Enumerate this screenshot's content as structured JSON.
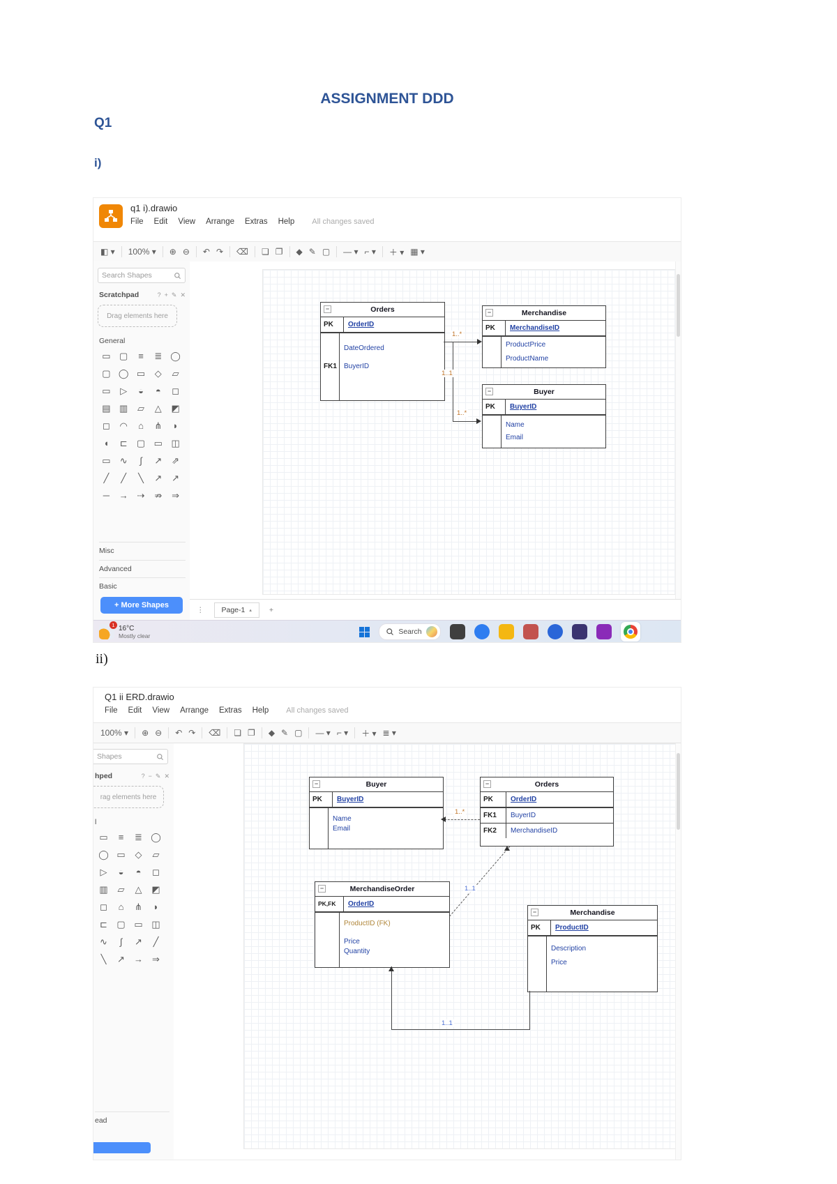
{
  "colors": {
    "heading_blue": "#2e5496",
    "drawio_orange": "#f08705",
    "accent_button_blue": "#4c8ffb",
    "er_field_blue": "#2242a4",
    "edge_label_orange": "#c0762a",
    "edge_label_blue": "#4a6fd4"
  },
  "doc": {
    "title": "ASSIGNMENT DDD",
    "q_label": "Q1",
    "part_i": "i)",
    "part_ii": "ii)"
  },
  "shot1": {
    "app_title": "q1 i).drawio",
    "menu": [
      "File",
      "Edit",
      "View",
      "Arrange",
      "Extras",
      "Help"
    ],
    "status": "All changes saved",
    "toolbar": {
      "items": [
        {
          "name": "view-button",
          "glyph": "◧ ▾"
        },
        {
          "name": "divider",
          "glyph": ""
        },
        {
          "name": "zoom-level-button",
          "glyph": "100% ▾"
        },
        {
          "name": "divider",
          "glyph": ""
        },
        {
          "name": "zoom-in-button",
          "glyph": "⊕"
        },
        {
          "name": "zoom-out-button",
          "glyph": "⊖"
        },
        {
          "name": "divider",
          "glyph": ""
        },
        {
          "name": "undo-button",
          "glyph": "↶"
        },
        {
          "name": "redo-button",
          "glyph": "↷"
        },
        {
          "name": "divider",
          "glyph": ""
        },
        {
          "name": "delete-button",
          "glyph": "⌫"
        },
        {
          "name": "divider",
          "glyph": ""
        },
        {
          "name": "to-front-button",
          "glyph": "❏"
        },
        {
          "name": "to-back-button",
          "glyph": "❐"
        },
        {
          "name": "divider",
          "glyph": ""
        },
        {
          "name": "fill-color-button",
          "glyph": "◆"
        },
        {
          "name": "line-color-button",
          "glyph": "✎"
        },
        {
          "name": "shadow-button",
          "glyph": "▢"
        },
        {
          "name": "divider",
          "glyph": ""
        },
        {
          "name": "connection-style-button",
          "glyph": "— ▾"
        },
        {
          "name": "waypoints-button",
          "glyph": "⌐ ▾"
        },
        {
          "name": "divider",
          "glyph": ""
        },
        {
          "name": "insert-button",
          "glyph": "＋ ▾"
        },
        {
          "name": "table-button",
          "glyph": "▦ ▾"
        }
      ]
    },
    "panel": {
      "search": "Search Shapes",
      "scratchpad": "Scratchpad",
      "scratchpad_icons": [
        "?",
        "+",
        "✎",
        "✕"
      ],
      "drag_hint": "Drag elements here",
      "general": "General",
      "sections": [
        "Misc",
        "Advanced",
        "Basic"
      ],
      "more_shapes": "+ More Shapes",
      "glyphs": [
        "▭",
        "▢",
        "≡",
        "≣",
        "◯",
        "▢",
        "◯",
        "▭",
        "◇",
        "▱",
        "▭",
        "▷",
        "◒",
        "◓",
        "◻",
        "▤",
        "▥",
        "▱",
        "△",
        "◩",
        "◻",
        "◠",
        "⌂",
        "⋔",
        "◗",
        "◖",
        "⊏",
        "▢",
        "▭",
        "◫",
        "▭",
        "∿",
        "∫",
        "↗",
        "⇗",
        "╱",
        "╱",
        "╲",
        "↗",
        "↗",
        "─",
        "→",
        "⇢",
        "⇏",
        "⇒"
      ]
    },
    "page_tab": "Page-1",
    "erd": {
      "orders": {
        "title": "Orders",
        "pk_key": "PK",
        "pk_field": "OrderID",
        "rows": [
          {
            "key": "",
            "field": "DateOrdered"
          },
          {
            "key": "FK1",
            "field": "BuyerID"
          }
        ]
      },
      "merchandise": {
        "title": "Merchandise",
        "pk_key": "PK",
        "pk_field": "MerchandiseID",
        "rows": [
          {
            "key": "",
            "field": "ProductPrice"
          },
          {
            "key": "",
            "field": "ProductName"
          }
        ]
      },
      "buyer": {
        "title": "Buyer",
        "pk_key": "PK",
        "pk_field": "BuyerID",
        "rows": [
          {
            "key": "",
            "field": "Name"
          },
          {
            "key": "",
            "field": "Email"
          }
        ]
      },
      "labels": {
        "orders_merchandise": "1..*",
        "orders_mid": "1..1",
        "orders_buyer": "1..*"
      }
    },
    "taskbar": {
      "temp": "16°C",
      "weather": "Mostly clear",
      "badge": "1",
      "search": "Search"
    }
  },
  "shot2": {
    "app_title": "Q1 ii ERD.drawio",
    "menu": [
      "File",
      "Edit",
      "View",
      "Arrange",
      "Extras",
      "Help"
    ],
    "status": "All changes saved",
    "toolbar": {
      "items": [
        {
          "name": "zoom-level-button",
          "glyph": "100% ▾"
        },
        {
          "name": "divider",
          "glyph": ""
        },
        {
          "name": "zoom-in-button",
          "glyph": "⊕"
        },
        {
          "name": "zoom-out-button",
          "glyph": "⊖"
        },
        {
          "name": "divider",
          "glyph": ""
        },
        {
          "name": "undo-button",
          "glyph": "↶"
        },
        {
          "name": "redo-button",
          "glyph": "↷"
        },
        {
          "name": "divider",
          "glyph": ""
        },
        {
          "name": "delete-button",
          "glyph": "⌫"
        },
        {
          "name": "divider",
          "glyph": ""
        },
        {
          "name": "to-front-button",
          "glyph": "❏"
        },
        {
          "name": "to-back-button",
          "glyph": "❐"
        },
        {
          "name": "divider",
          "glyph": ""
        },
        {
          "name": "fill-color-button",
          "glyph": "◆"
        },
        {
          "name": "line-color-button",
          "glyph": "✎"
        },
        {
          "name": "shadow-button",
          "glyph": "▢"
        },
        {
          "name": "divider",
          "glyph": ""
        },
        {
          "name": "connection-style-button",
          "glyph": "— ▾"
        },
        {
          "name": "waypoints-button",
          "glyph": "⌐ ▾"
        },
        {
          "name": "divider",
          "glyph": ""
        },
        {
          "name": "insert-button",
          "glyph": "＋ ▾"
        },
        {
          "name": "outline-button",
          "glyph": "≣ ▾"
        }
      ]
    },
    "panel": {
      "search": "Shapes",
      "scratchpad": "hped",
      "scratchpad_icons": [
        "?",
        "−",
        "✎",
        "✕"
      ],
      "drag_hint": "rag elements here",
      "general": "l",
      "bottom_fragment": "ead",
      "glyphs": [
        "▭",
        "≡",
        "≣",
        "◯",
        "◯",
        "▭",
        "◇",
        "▱",
        "▷",
        "◒",
        "◓",
        "◻",
        "▥",
        "▱",
        "△",
        "◩",
        "◻",
        "⌂",
        "⋔",
        "◗",
        "⊏",
        "▢",
        "▭",
        "◫",
        "∿",
        "∫",
        "↗",
        "╱",
        "╲",
        "↗",
        "→",
        "⇒"
      ]
    },
    "erd": {
      "buyer": {
        "title": "Buyer",
        "pk_key": "PK",
        "pk_field": "BuyerID",
        "rows": [
          {
            "key": "",
            "field": "Name"
          },
          {
            "key": "",
            "field": "Email"
          }
        ]
      },
      "orders": {
        "title": "Orders",
        "rows": [
          {
            "key": "PK",
            "field": "OrderID"
          },
          {
            "key": "FK1",
            "field": "BuyerID"
          },
          {
            "key": "FK2",
            "field": "MerchandiseID"
          }
        ]
      },
      "merchandise_order": {
        "title": "MerchandiseOrder",
        "pk_key": "PK,FK",
        "pk_field": "OrderID",
        "rows": [
          {
            "key": "",
            "field": "ProductID (FK)"
          },
          {
            "key": "",
            "field": "Price"
          },
          {
            "key": "",
            "field": "Quantity"
          }
        ]
      },
      "merchandise": {
        "title": "Merchandise",
        "pk_key": "PK",
        "pk_field": "ProductID",
        "rows": [
          {
            "key": "",
            "field": "Description"
          },
          {
            "key": "",
            "field": "Price"
          }
        ]
      },
      "labels": {
        "orders_buyer": "1..*",
        "mo_orders": "1..1",
        "merchandise_mo": "1..1"
      }
    }
  }
}
